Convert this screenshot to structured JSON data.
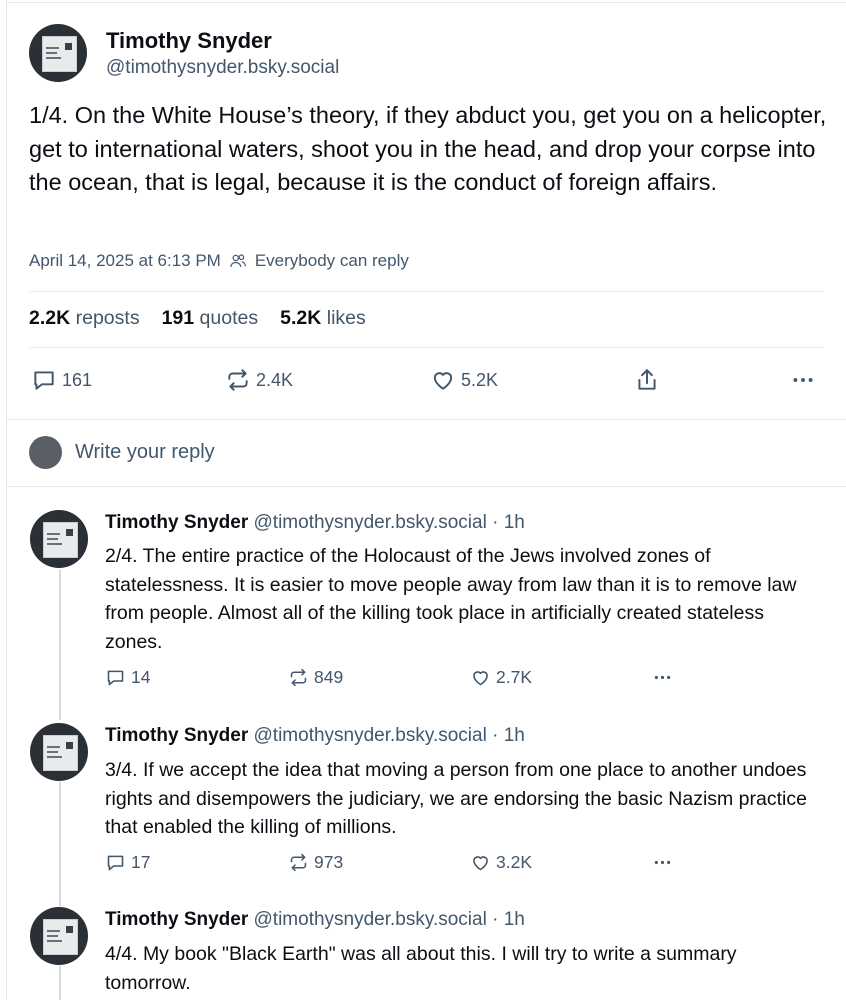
{
  "main_post": {
    "author_name": "Timothy Snyder",
    "author_handle": "@timothysnyder.bsky.social",
    "text": "1/4. On the White House’s theory, if they abduct you, get you on a helicopter, get to international waters, shoot you in the head, and drop your corpse into the ocean, that is legal, because it is the conduct of foreign affairs.",
    "timestamp": "April 14, 2025 at 6:13 PM",
    "reply_setting": "Everybody can reply",
    "stats": {
      "reposts_count": "2.2K",
      "reposts_label": "reposts",
      "quotes_count": "191",
      "quotes_label": "quotes",
      "likes_count": "5.2K",
      "likes_label": "likes"
    },
    "actions": {
      "replies": "161",
      "reposts": "2.4K",
      "likes": "5.2K"
    }
  },
  "reply_box": {
    "placeholder": "Write your reply"
  },
  "thread": [
    {
      "author_name": "Timothy Snyder",
      "author_handle": "@timothysnyder.bsky.social · 1h",
      "text": "2/4. The entire practice of the Holocaust of the Jews involved zones of statelessness. It is easier to move people away from law than it is to remove law from people. Almost all of the killing took place in artificially created stateless zones.",
      "replies": "14",
      "reposts": "849",
      "likes": "2.7K"
    },
    {
      "author_name": "Timothy Snyder",
      "author_handle": "@timothysnyder.bsky.social · 1h",
      "text": "3/4. If we accept the idea that moving a person from one place to another undoes rights and disempowers the judiciary, we are endorsing the basic Nazism practice that enabled the killing of millions.",
      "replies": "17",
      "reposts": "973",
      "likes": "3.2K"
    },
    {
      "author_name": "Timothy Snyder",
      "author_handle": "@timothysnyder.bsky.social · 1h",
      "text": "4/4. My book \"Black Earth\" was all about this. I will try to write a summary tomorrow."
    }
  ],
  "icons": {
    "reply": "speech-bubble-icon",
    "repost": "repost-arrows-icon",
    "like": "heart-icon",
    "share": "share-icon",
    "more": "ellipsis-icon",
    "audience": "people-icon"
  },
  "colors": {
    "text": "#0b0f14",
    "muted": "#42576c",
    "divider": "#e6e8eb",
    "thread_line": "#d4d9de"
  }
}
